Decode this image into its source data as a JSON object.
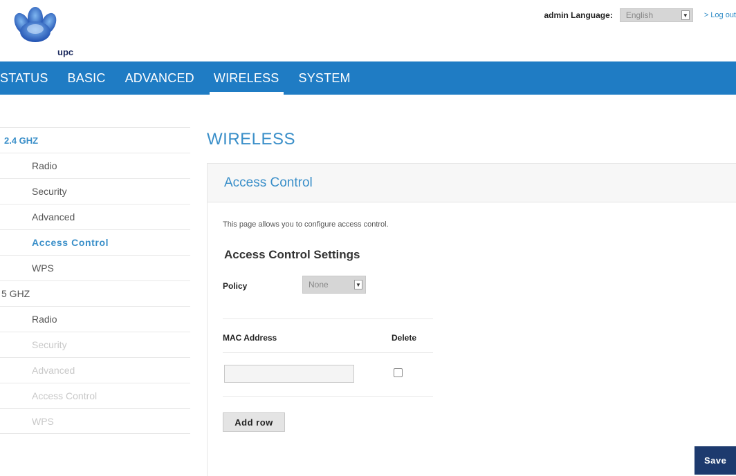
{
  "brand": {
    "logo_text": "upc"
  },
  "header": {
    "admin_label": "admin Language:",
    "language_value": "English",
    "logout_label": "> Log out"
  },
  "nav": {
    "items": [
      {
        "label": "STATUS"
      },
      {
        "label": "BASIC"
      },
      {
        "label": "ADVANCED"
      },
      {
        "label": "WIRELESS",
        "active": true
      },
      {
        "label": "SYSTEM"
      }
    ]
  },
  "sidebar": {
    "groups": [
      {
        "label": "2.4 GHZ",
        "active": true,
        "items": [
          "Radio",
          "Security",
          "Advanced",
          "Access Control",
          "WPS"
        ],
        "current": "Access Control"
      },
      {
        "label": "5 GHZ",
        "active": false,
        "items": [
          "Radio",
          "Security",
          "Advanced",
          "Access Control",
          "WPS"
        ],
        "disabled_items": [
          "Security",
          "Advanced",
          "Access Control",
          "WPS"
        ]
      }
    ]
  },
  "main": {
    "page_title": "WIRELESS",
    "panel_title": "Access Control",
    "description": "This page allows you to configure access control.",
    "settings_title": "Access Control Settings",
    "policy_label": "Policy",
    "policy_value": "None",
    "table": {
      "col_mac": "MAC Address",
      "col_delete": "Delete",
      "rows": [
        {
          "mac": "",
          "delete": false
        }
      ]
    },
    "add_row_label": "Add row",
    "save_label": "Save"
  },
  "colors": {
    "nav_bg": "#1f7cc4",
    "accent": "#3a8fc9",
    "save_bg": "#1d3a6e"
  }
}
